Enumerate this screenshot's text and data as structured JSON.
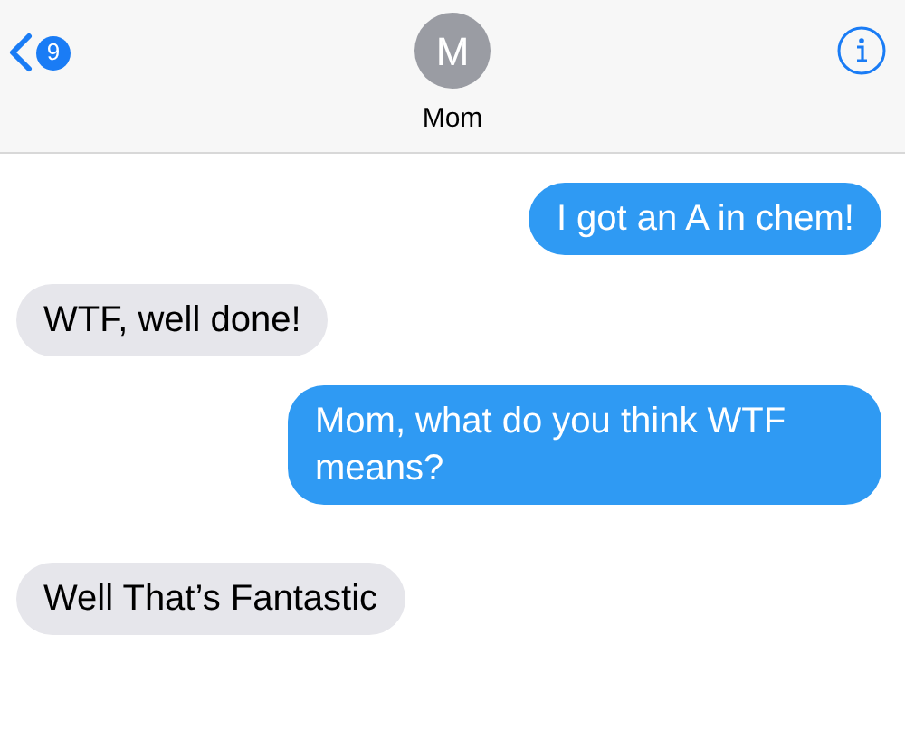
{
  "header": {
    "unread_count": "9",
    "avatar_initial": "M",
    "contact_name": "Mom"
  },
  "messages": [
    {
      "kind": "sent",
      "text": "I got an A in chem!"
    },
    {
      "kind": "received",
      "text": "WTF, well done!"
    },
    {
      "kind": "sent",
      "text": "Mom, what do you think WTF means?"
    },
    {
      "kind": "received",
      "text": "Well That’s Fantastic"
    }
  ]
}
